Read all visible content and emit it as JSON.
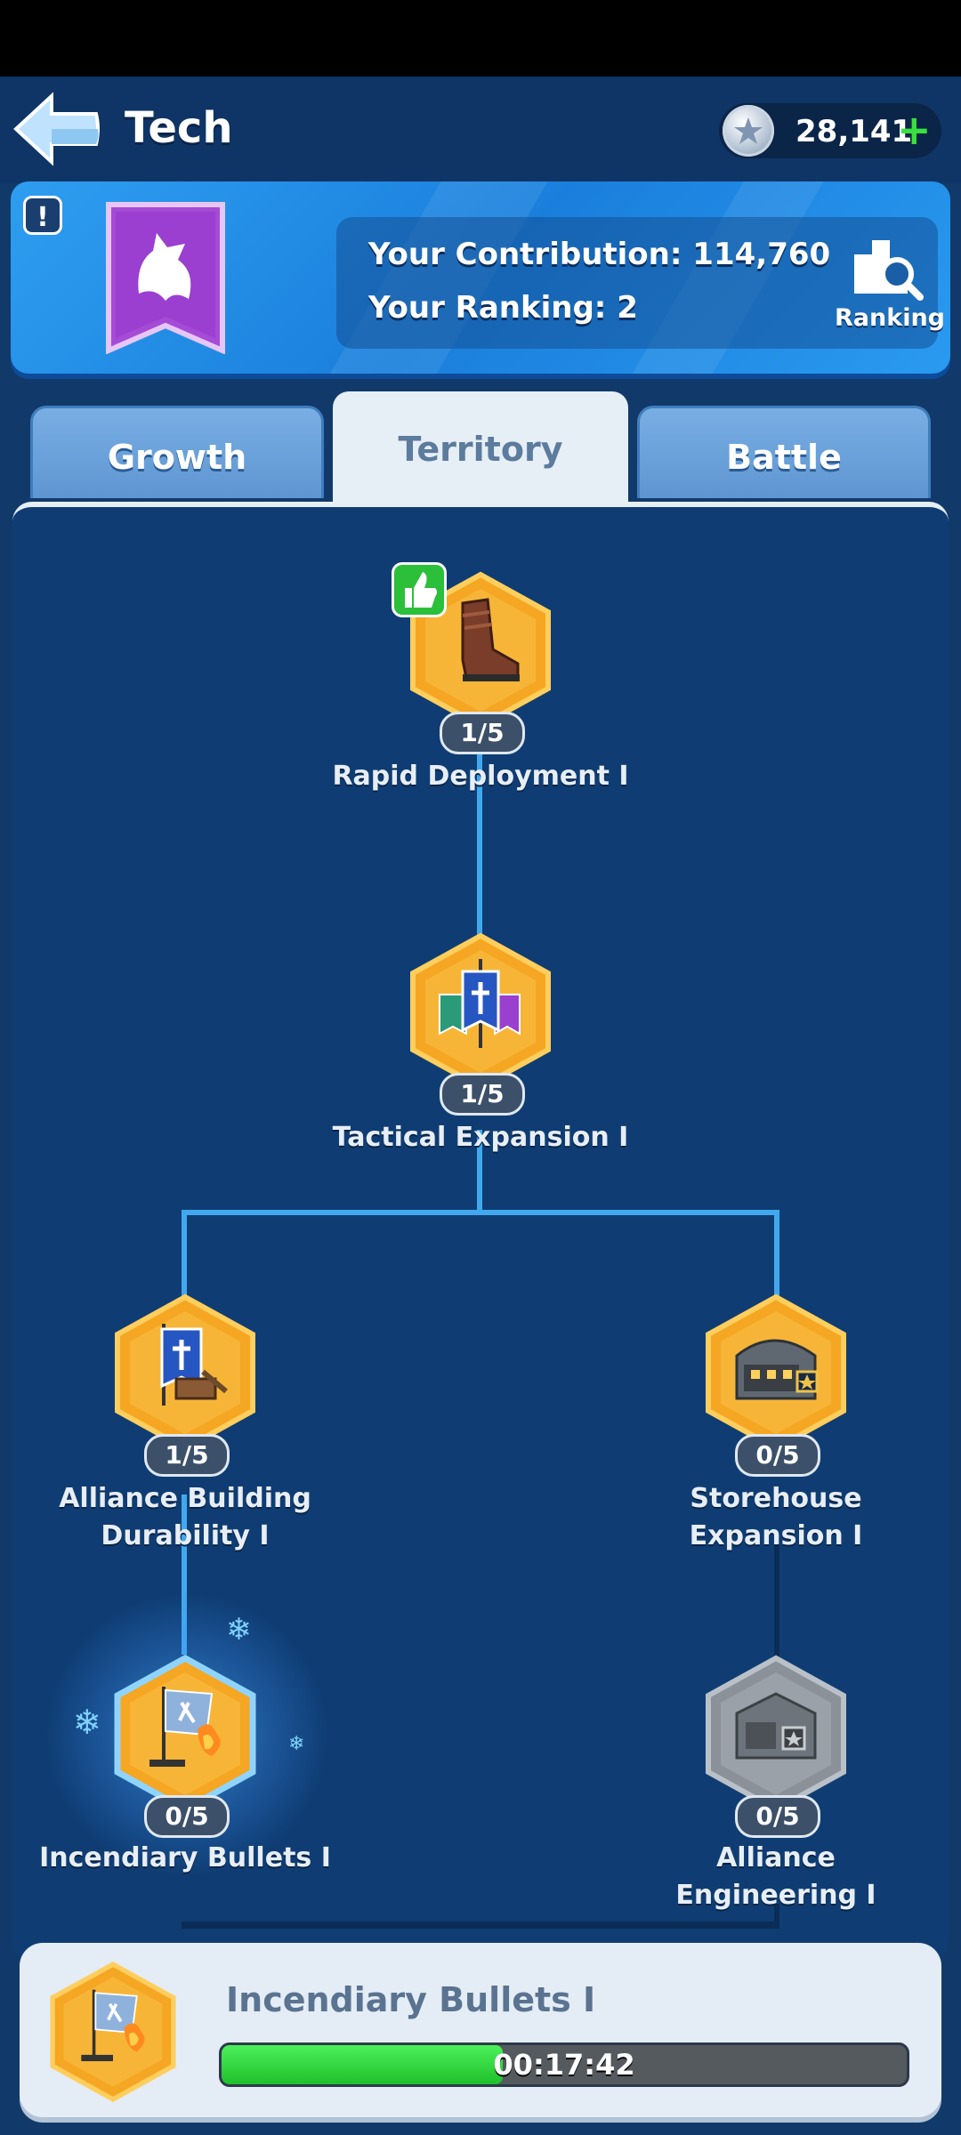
{
  "header": {
    "title": "Tech",
    "currency_value": "28,141"
  },
  "banner": {
    "contribution_label": "Your Contribution: 114,760",
    "ranking_label": "Your Ranking: 2",
    "ranking_button": "Ranking"
  },
  "tabs": [
    {
      "label": "Growth",
      "active": false
    },
    {
      "label": "Territory",
      "active": true
    },
    {
      "label": "Battle",
      "active": false
    }
  ],
  "tree": {
    "nodes": [
      {
        "id": "rapid-deployment",
        "label": "Rapid Deployment I",
        "level": "1/5",
        "recommended": true
      },
      {
        "id": "tactical-expansion",
        "label": "Tactical Expansion I",
        "level": "1/5"
      },
      {
        "id": "alliance-building-durability",
        "label": "Alliance Building Durability I",
        "level": "1/5"
      },
      {
        "id": "storehouse-expansion",
        "label": "Storehouse Expansion I",
        "level": "0/5"
      },
      {
        "id": "incendiary-bullets",
        "label": "Incendiary Bullets I",
        "level": "0/5",
        "researching": true
      },
      {
        "id": "alliance-engineering",
        "label": "Alliance Engineering I",
        "level": "0/5",
        "locked": true
      }
    ]
  },
  "research": {
    "title": "Incendiary Bullets I",
    "timer": "00:17:42",
    "progress": 0.41
  },
  "colors": {
    "background": "#113a6b",
    "connector": "#42a8ee",
    "progress_green": "#2fd03a",
    "hex_gold": "#f5a623"
  }
}
